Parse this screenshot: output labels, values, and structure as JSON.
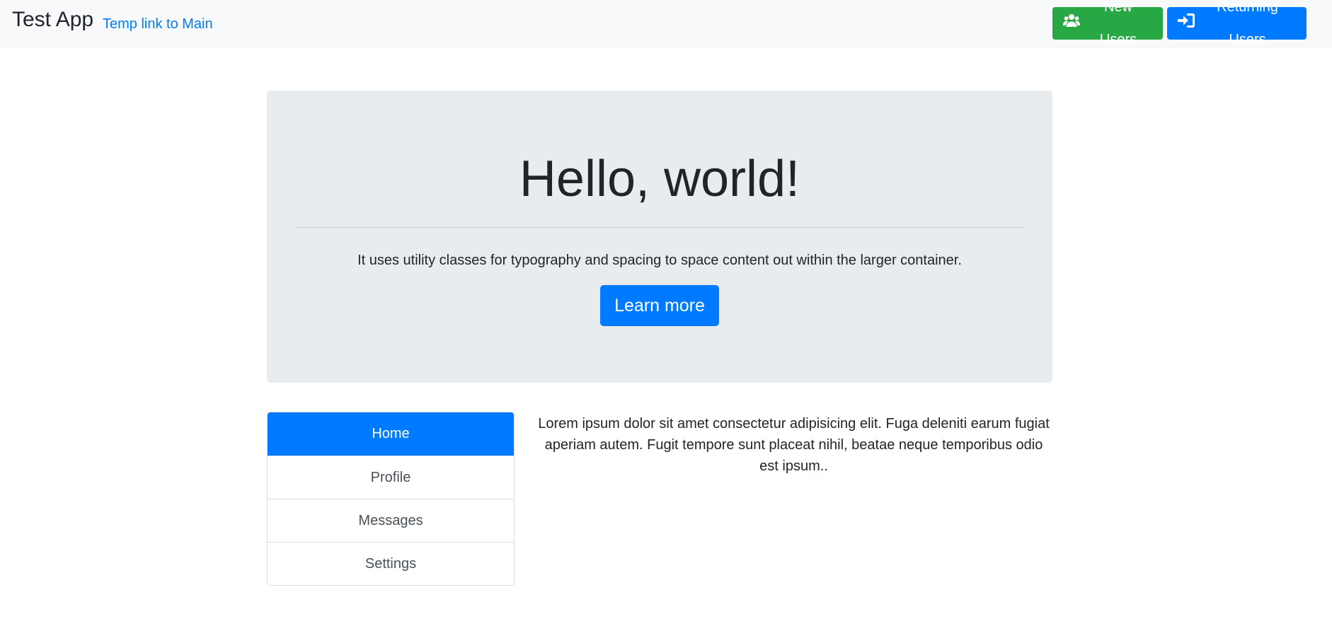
{
  "navbar": {
    "brand": "Test App",
    "link": "Temp link to Main",
    "new_users_label": "New Users",
    "new_users_icon": "users-icon",
    "returning_users_label": "Returning Users",
    "returning_users_icon": "sign-in-icon"
  },
  "jumbotron": {
    "title": "Hello, world!",
    "lead": "It uses utility classes for typography and spacing to space content out within the larger container.",
    "button_label": "Learn more"
  },
  "list_group": {
    "items": [
      {
        "label": "Home",
        "active": true
      },
      {
        "label": "Profile",
        "active": false
      },
      {
        "label": "Messages",
        "active": false
      },
      {
        "label": "Settings",
        "active": false
      }
    ]
  },
  "content": {
    "text": "Lorem ipsum dolor sit amet consectetur adipisicing elit. Fuga deleniti earum fugiat aperiam autem. Fugit tempore sunt placeat nihil, beatae neque temporibus odio est ipsum.."
  },
  "colors": {
    "primary": "#007bff",
    "success": "#28a745",
    "navbar_bg": "#f8f9fa",
    "jumbotron_bg": "#e9ecef"
  }
}
